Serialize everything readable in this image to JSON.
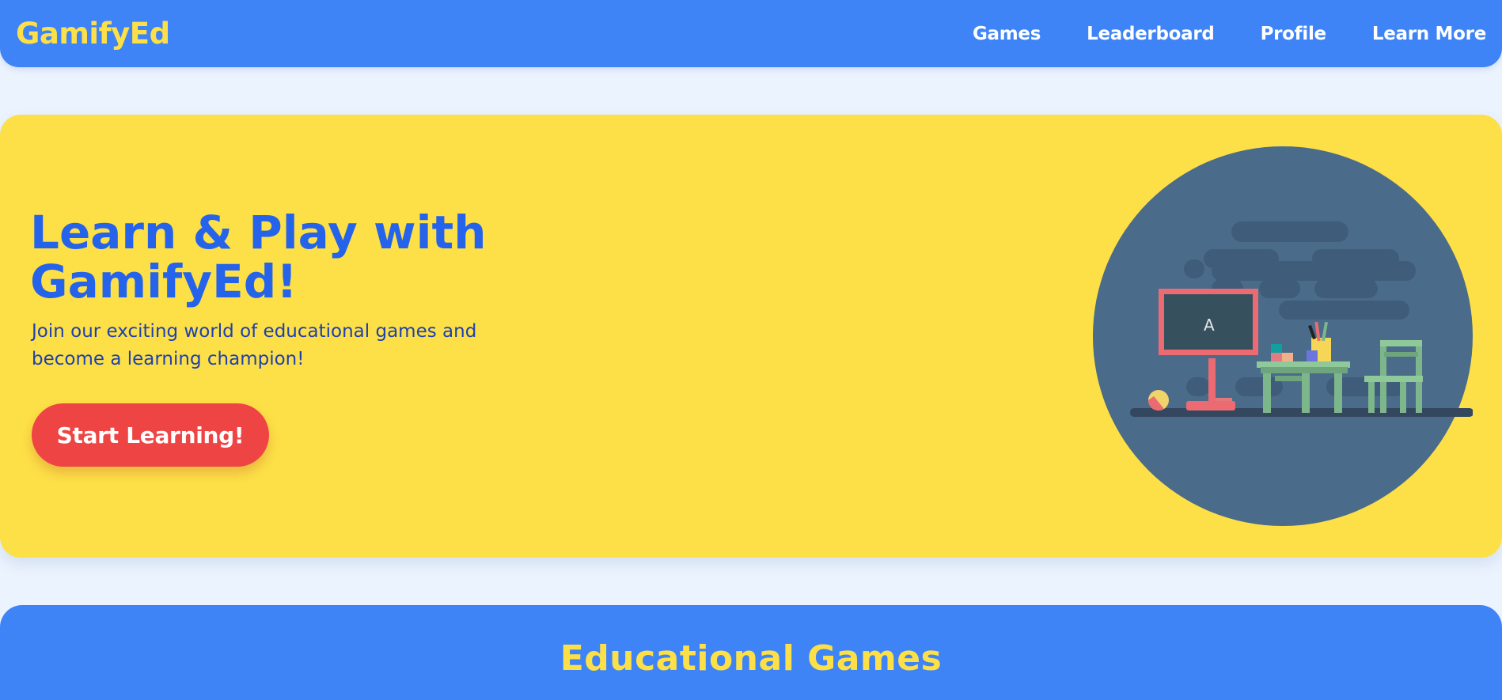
{
  "app": {
    "brand": "GamifyEd"
  },
  "nav": {
    "items": [
      {
        "label": "Games"
      },
      {
        "label": "Leaderboard"
      },
      {
        "label": "Profile"
      },
      {
        "label": "Learn More"
      }
    ]
  },
  "hero": {
    "title": "Learn & Play with GamifyEd!",
    "subtitle": "Join our exciting world of educational games and become a learning champion!",
    "cta_label": "Start Learning!",
    "illustration_board_letter": "A"
  },
  "games_section": {
    "title": "Educational Games"
  },
  "colors": {
    "primary_blue": "#3e84f6",
    "accent_yellow": "#fde047",
    "heading_blue": "#2563eb",
    "cta_red": "#ef4444",
    "page_bg": "#ebf3fe"
  }
}
